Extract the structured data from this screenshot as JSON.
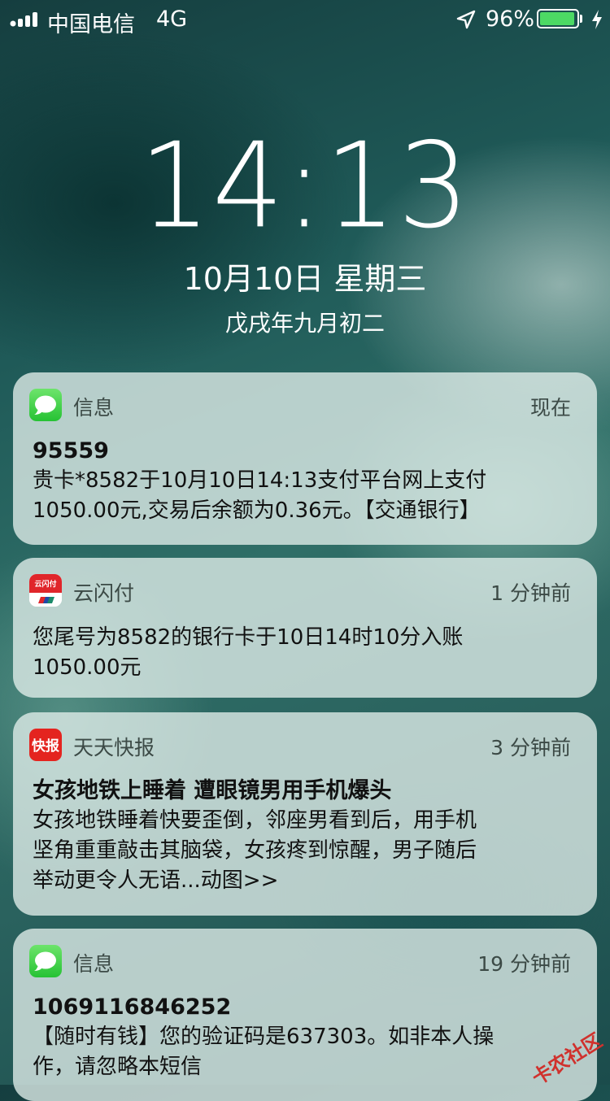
{
  "status_bar": {
    "carrier": "中国电信",
    "network": "4G",
    "battery_percent_text": "96%",
    "battery_level": 0.96,
    "battery_color": "#4cd964",
    "icons": [
      "signal-bars-icon",
      "location-arrow-icon",
      "battery-icon",
      "charging-bolt-icon"
    ]
  },
  "lock_screen": {
    "time": "14:13",
    "date": "10月10日 星期三",
    "lunar_date": "戊戌年九月初二"
  },
  "notifications": [
    {
      "app": "信息",
      "time": "现在",
      "icon": "messages-icon",
      "title": "95559",
      "text": "贵卡*8582于10月10日14:13支付平台网上支付\n1050.00元,交易后余额为0.36元。【交通银行】"
    },
    {
      "app": "云闪付",
      "time": "1 分钟前",
      "icon": "unionpay-icon",
      "icon_text": "云闪付",
      "title": "",
      "text": "您尾号为8582的银行卡于10日14时10分入账\n1050.00元"
    },
    {
      "app": "天天快报",
      "time": "3 分钟前",
      "icon": "kuaibao-icon",
      "icon_text": "快报",
      "title": "女孩地铁上睡着 遭眼镜男用手机爆头",
      "text": "女孩地铁睡着快要歪倒，邻座男看到后，用手机\n坚角重重敲击其脑袋，女孩疼到惊醒，男子随后\n举动更令人无语...动图>>"
    },
    {
      "app": "信息",
      "time": "19 分钟前",
      "icon": "messages-icon",
      "title": "1069116846252",
      "text": "【随时有钱】您的验证码是637303。如非本人操\n作，请忽略本短信"
    }
  ],
  "watermark": "卡农社区"
}
